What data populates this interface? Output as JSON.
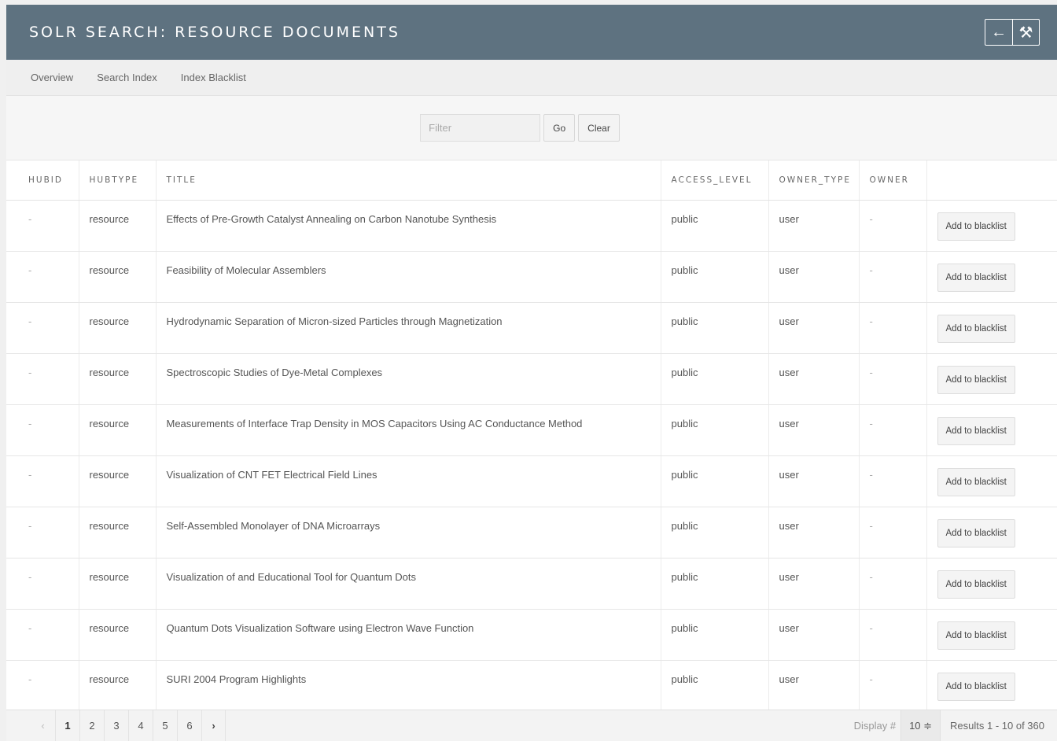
{
  "header": {
    "title": "SOLR SEARCH: RESOURCE DOCUMENTS",
    "back_icon": "←",
    "options_icon": "⚒"
  },
  "subnav": {
    "items": [
      "Overview",
      "Search Index",
      "Index Blacklist"
    ]
  },
  "filter": {
    "placeholder": "Filter",
    "value": "",
    "go_label": "Go",
    "clear_label": "Clear"
  },
  "table": {
    "columns": [
      "HUBID",
      "HUBTYPE",
      "TITLE",
      "ACCESS_LEVEL",
      "OWNER_TYPE",
      "OWNER"
    ],
    "action_label": "Add to blacklist",
    "rows": [
      {
        "hubid": "-",
        "hubtype": "resource",
        "title": "Effects of Pre-Growth Catalyst Annealing on Carbon Nanotube Synthesis",
        "access_level": "public",
        "owner_type": "user",
        "owner": "-"
      },
      {
        "hubid": "-",
        "hubtype": "resource",
        "title": "Feasibility of Molecular Assemblers",
        "access_level": "public",
        "owner_type": "user",
        "owner": "-"
      },
      {
        "hubid": "-",
        "hubtype": "resource",
        "title": "Hydrodynamic Separation of Micron-sized Particles through Magnetization",
        "access_level": "public",
        "owner_type": "user",
        "owner": "-"
      },
      {
        "hubid": "-",
        "hubtype": "resource",
        "title": "Spectroscopic Studies of Dye-Metal Complexes",
        "access_level": "public",
        "owner_type": "user",
        "owner": "-"
      },
      {
        "hubid": "-",
        "hubtype": "resource",
        "title": "Measurements of Interface Trap Density in MOS Capacitors Using AC Conductance Method",
        "access_level": "public",
        "owner_type": "user",
        "owner": "-"
      },
      {
        "hubid": "-",
        "hubtype": "resource",
        "title": "Visualization of CNT FET Electrical Field Lines",
        "access_level": "public",
        "owner_type": "user",
        "owner": "-"
      },
      {
        "hubid": "-",
        "hubtype": "resource",
        "title": "Self-Assembled Monolayer of DNA Microarrays",
        "access_level": "public",
        "owner_type": "user",
        "owner": "-"
      },
      {
        "hubid": "-",
        "hubtype": "resource",
        "title": "Visualization of and Educational Tool for Quantum Dots",
        "access_level": "public",
        "owner_type": "user",
        "owner": "-"
      },
      {
        "hubid": "-",
        "hubtype": "resource",
        "title": "Quantum Dots Visualization Software using Electron Wave Function",
        "access_level": "public",
        "owner_type": "user",
        "owner": "-"
      },
      {
        "hubid": "-",
        "hubtype": "resource",
        "title": "SURI 2004 Program Highlights",
        "access_level": "public",
        "owner_type": "user",
        "owner": "-"
      }
    ]
  },
  "pagination": {
    "prev_icon": "‹",
    "next_icon": "›",
    "pages": [
      "1",
      "2",
      "3",
      "4",
      "5",
      "6"
    ],
    "current_page": "1",
    "display_label": "Display #",
    "display_value": "10 ≑",
    "results_text": "Results 1 - 10 of 360"
  }
}
